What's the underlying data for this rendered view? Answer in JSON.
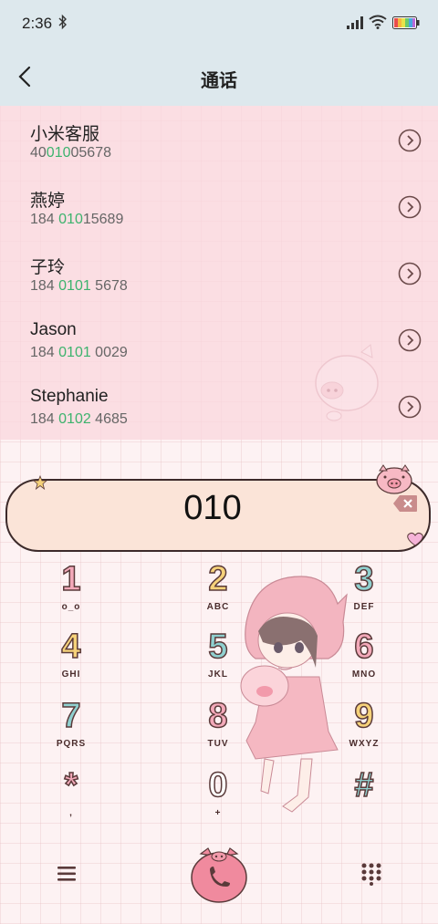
{
  "status": {
    "time": "2:36"
  },
  "header": {
    "title": "通话"
  },
  "contacts": [
    {
      "name": "小米客服",
      "pre": "40",
      "match": "010",
      "post": "05678"
    },
    {
      "name": "燕婷",
      "pre": "184 ",
      "match": "010",
      "post": "15689"
    },
    {
      "name": "子玲",
      "pre": "184 ",
      "match": "0101",
      "post": " 5678"
    },
    {
      "name": "Jason",
      "pre": "184 ",
      "match": "0101",
      "post": " 0029"
    },
    {
      "name": "Stephanie",
      "pre": "184 ",
      "match": "0102",
      "post": " 4685"
    }
  ],
  "dial": {
    "digits": "010"
  },
  "keypad": [
    {
      "digit": "1",
      "letters": "o_o"
    },
    {
      "digit": "2",
      "letters": "ABC"
    },
    {
      "digit": "3",
      "letters": "DEF"
    },
    {
      "digit": "4",
      "letters": "GHI"
    },
    {
      "digit": "5",
      "letters": "JKL"
    },
    {
      "digit": "6",
      "letters": "MNO"
    },
    {
      "digit": "7",
      "letters": "PQRS"
    },
    {
      "digit": "8",
      "letters": "TUV"
    },
    {
      "digit": "9",
      "letters": "WXYZ"
    },
    {
      "digit": "*",
      "letters": ","
    },
    {
      "digit": "0",
      "letters": "+"
    },
    {
      "digit": "#",
      "letters": ""
    }
  ],
  "colors": {
    "header_bg": "#dde8ed",
    "list_bg": "#fad7de",
    "match_green": "#3db36e",
    "accent_pink": "#f08a9e"
  }
}
